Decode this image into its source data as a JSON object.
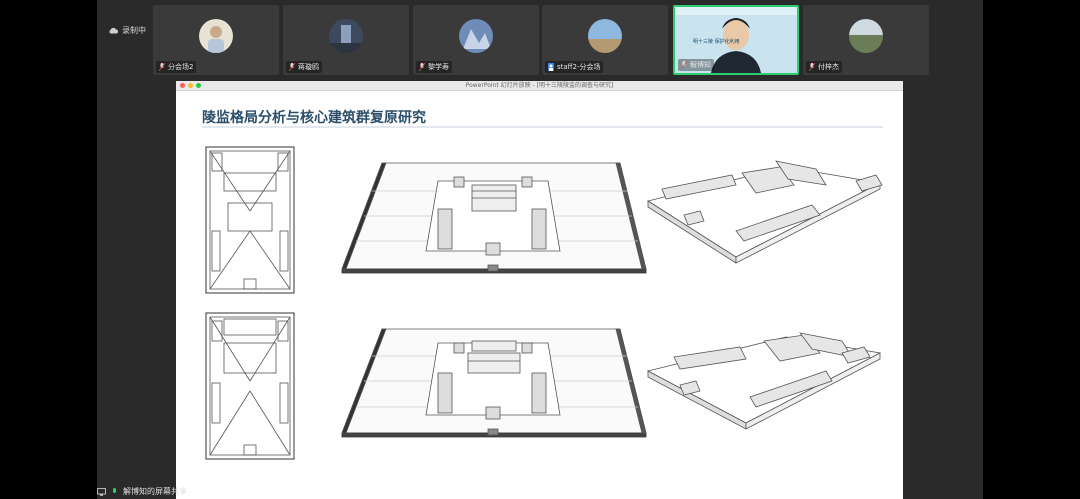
{
  "recording": {
    "label": "录制中",
    "icon": "cloud-icon"
  },
  "participants": [
    {
      "name": "分会场2",
      "avatar_color": "#d9c9a8",
      "muted": true
    },
    {
      "name": "蒋璇鸥",
      "avatar_color": "#5a6b84",
      "muted": true
    },
    {
      "name": "黎学寿",
      "avatar_color": "#6f8bb8",
      "muted": true
    },
    {
      "name": "staff2-分会场",
      "avatar_color": "#7aa6d1",
      "muted": false
    },
    {
      "name": "解博知",
      "active": true,
      "muted": true,
      "banner": "明十三陵 保护化利用"
    },
    {
      "name": "付梓杰",
      "avatar_color": "#8ea07a",
      "muted": true
    }
  ],
  "window": {
    "title": "PowerPoint 幻灯片放映 - [明十三陵陵监的调查与研究]"
  },
  "slide": {
    "title": "陵监格局分析与核心建筑群复原研究"
  },
  "share": {
    "label": "解博知的屏幕共享"
  },
  "colors": {
    "accent": "#2ecc71",
    "title": "#2b4e6a"
  }
}
